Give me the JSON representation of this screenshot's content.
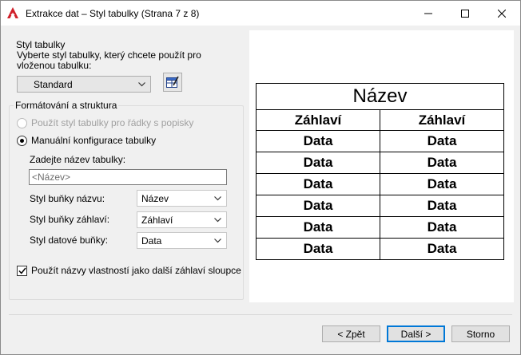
{
  "window": {
    "title": "Extrakce dat – Styl tabulky (Strana 7 z 8)"
  },
  "table_style": {
    "group_title": "Styl tabulky",
    "description": "Vyberte styl tabulky, který chcete použít pro vloženou tabulku:",
    "selected": "Standard"
  },
  "formatting": {
    "group_title": "Formátování a struktura",
    "radio_use_style": "Použít styl tabulky pro řádky s popisky",
    "radio_manual": "Manuální konfigurace tabulky",
    "name_label": "Zadejte název tabulky:",
    "name_placeholder": "<Název>",
    "title_cell_label": "Styl buňky názvu:",
    "title_cell_value": "Název",
    "header_cell_label": "Styl buňky záhlaví:",
    "header_cell_value": "Záhlaví",
    "data_cell_label": "Styl datové buňky:",
    "data_cell_value": "Data"
  },
  "checkbox_label": "Použít názvy vlastností jako další záhlaví sloupce",
  "preview": {
    "title": "Název",
    "headers": [
      "Záhlaví",
      "Záhlaví"
    ],
    "rows": [
      [
        "Data",
        "Data"
      ],
      [
        "Data",
        "Data"
      ],
      [
        "Data",
        "Data"
      ],
      [
        "Data",
        "Data"
      ],
      [
        "Data",
        "Data"
      ],
      [
        "Data",
        "Data"
      ]
    ]
  },
  "buttons": {
    "back": "< Zpět",
    "next": "Další >",
    "cancel": "Storno"
  },
  "colors": {
    "app_icon": "#d0202a",
    "accent": "#0078d7"
  }
}
